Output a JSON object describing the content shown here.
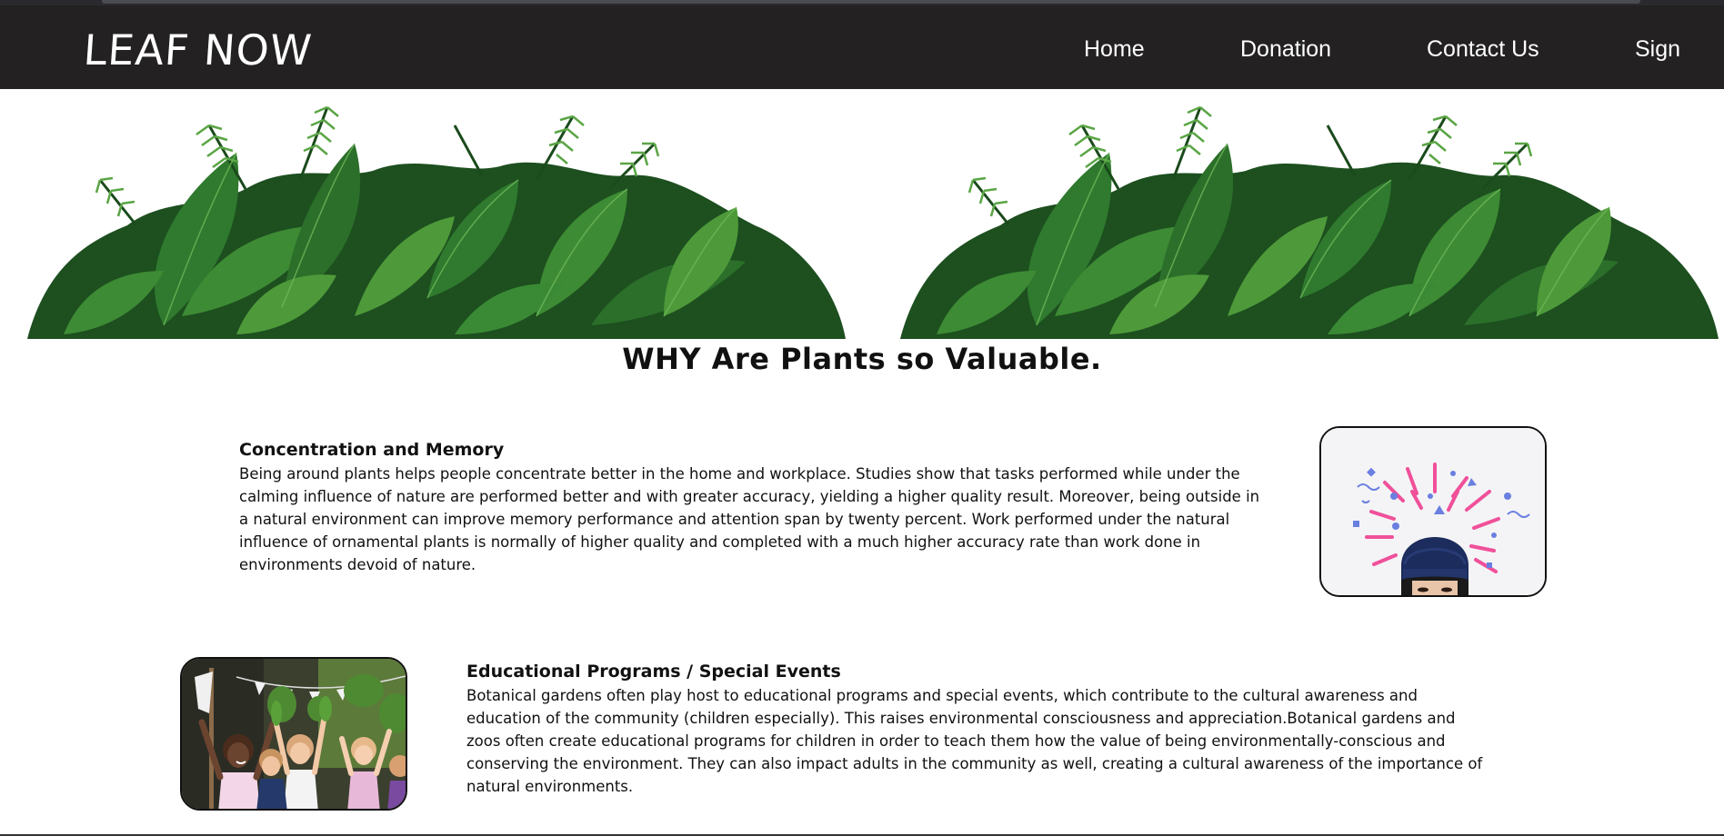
{
  "nav": {
    "logo": "LEAF NOW",
    "links": [
      {
        "label": "Home"
      },
      {
        "label": "Donation"
      },
      {
        "label": "Contact Us"
      },
      {
        "label": "Sign"
      }
    ]
  },
  "main": {
    "headline": "WHY Are Plants so Valuable.",
    "sections": [
      {
        "title": "Concentration and Memory",
        "text": "Being around plants helps people concentrate better in the home and workplace. Studies show that tasks performed while under the calming influence of nature are performed better and with greater accuracy, yielding a higher quality result. Moreover, being outside in a natural environment can improve memory performance and attention span by twenty percent. Work performed under the natural influence of ornamental plants is normally of higher quality and completed with a much higher accuracy rate than work done in environments devoid of nature."
      },
      {
        "title": "Educational Programs / Special Events",
        "text": "Botanical gardens often play host to educational programs and special events, which contribute to the cultural awareness and education of the community (children especially). This raises environmental consciousness and appreciation.Botanical gardens and zoos often create educational programs for children in order to teach them how the value of being environmentally-conscious and conserving the environment. They can also impact adults in the community as well, creating a cultural awareness of the importance of natural environments."
      }
    ]
  },
  "colors": {
    "navbar": "#232122",
    "leaf_dark": "#1f5a23",
    "leaf_mid": "#2f7a2e",
    "leaf_light": "#4e9a3a",
    "confetti_pink": "#f0509a",
    "confetti_blue": "#6a7fe0"
  }
}
